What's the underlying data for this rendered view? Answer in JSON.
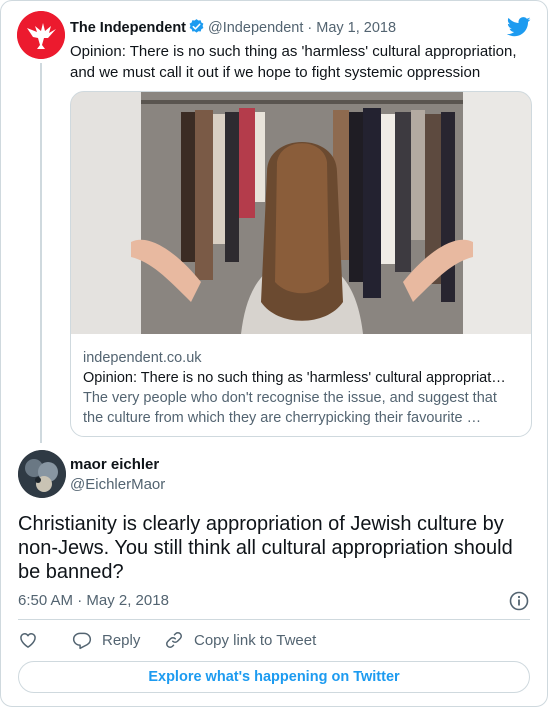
{
  "quoted_tweet": {
    "author_name": "The Independent",
    "handle": "@Independent",
    "separator": "·",
    "date": "May 1, 2018",
    "text": "Opinion: There is no such thing as 'harmless' cultural appropriation, and we must call it out if we hope to fight systemic oppression",
    "link_card": {
      "domain": "independent.co.uk",
      "title": "Opinion: There is no such thing as 'harmless' cultural appropriat…",
      "description": "The very people who don't recognise the issue, and suggest that the culture from which they are cherrypicking their favourite …"
    }
  },
  "tweet": {
    "author_name": "maor eichler",
    "handle": "@EichlerMaor",
    "text": "Christianity is clearly appropriation of Jewish culture by non-Jews. You still think all cultural appropriation should be banned?",
    "time": "6:50 AM · May 2, 2018"
  },
  "actions": {
    "reply_label": "Reply",
    "copy_link_label": "Copy link to Tweet"
  },
  "explore_label": "Explore what's happening on Twitter",
  "colors": {
    "twitter_blue": "#1d9bf0",
    "independent_red": "#ec1a2e",
    "text_secondary": "#536471",
    "border": "#cfd9de"
  },
  "icons": [
    "twitter-bird-icon",
    "verified-badge-icon",
    "info-icon",
    "heart-icon",
    "reply-icon",
    "link-icon"
  ]
}
